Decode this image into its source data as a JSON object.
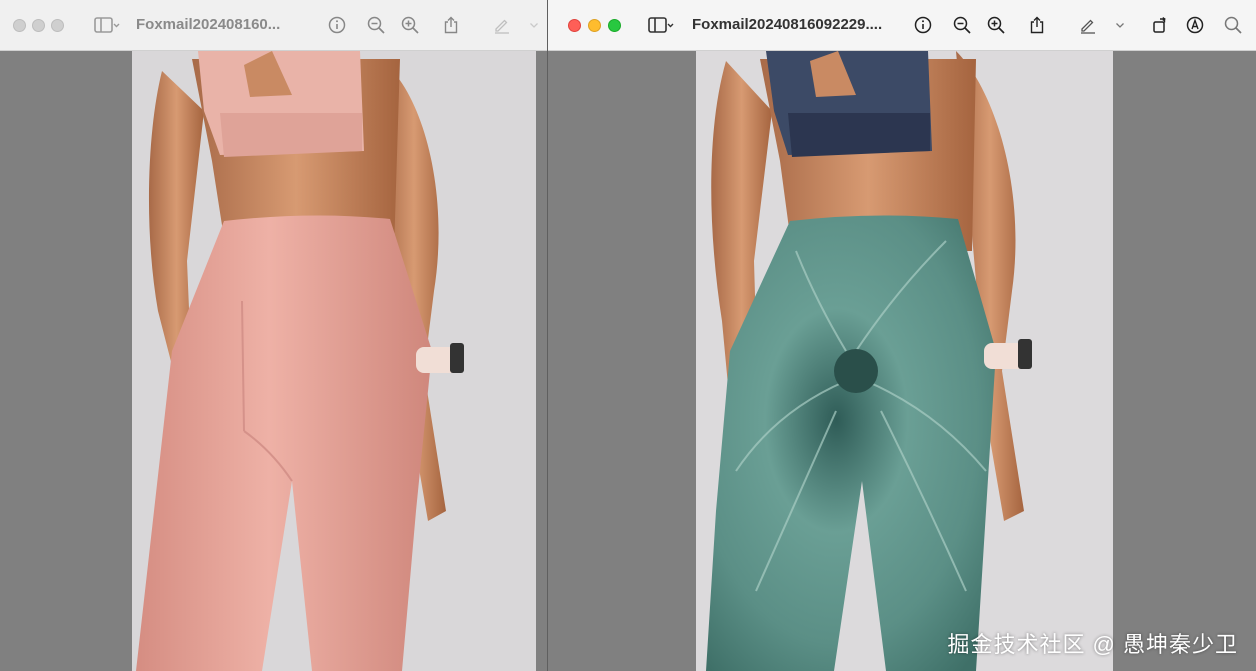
{
  "windows": [
    {
      "title": "Foxmail202408160...",
      "active": false
    },
    {
      "title": "Foxmail20240816092229....",
      "active": true
    }
  ],
  "icons": {
    "sidebar": "sidebar-toggle-icon",
    "info": "info-icon",
    "zoom_out": "zoom-out-icon",
    "zoom_in": "zoom-in-icon",
    "share": "share-icon",
    "markup": "markup-pen-icon",
    "chevron": "chevron-down-icon",
    "rotate": "rotate-icon",
    "annotate": "annotate-icon",
    "search": "search-icon"
  },
  "colors": {
    "leggings_left": "#e8a69b",
    "leggings_right": "#5c8f85",
    "skin": "#c98a63"
  },
  "watermark": "掘金技术社区 @ 愚坤秦少卫"
}
